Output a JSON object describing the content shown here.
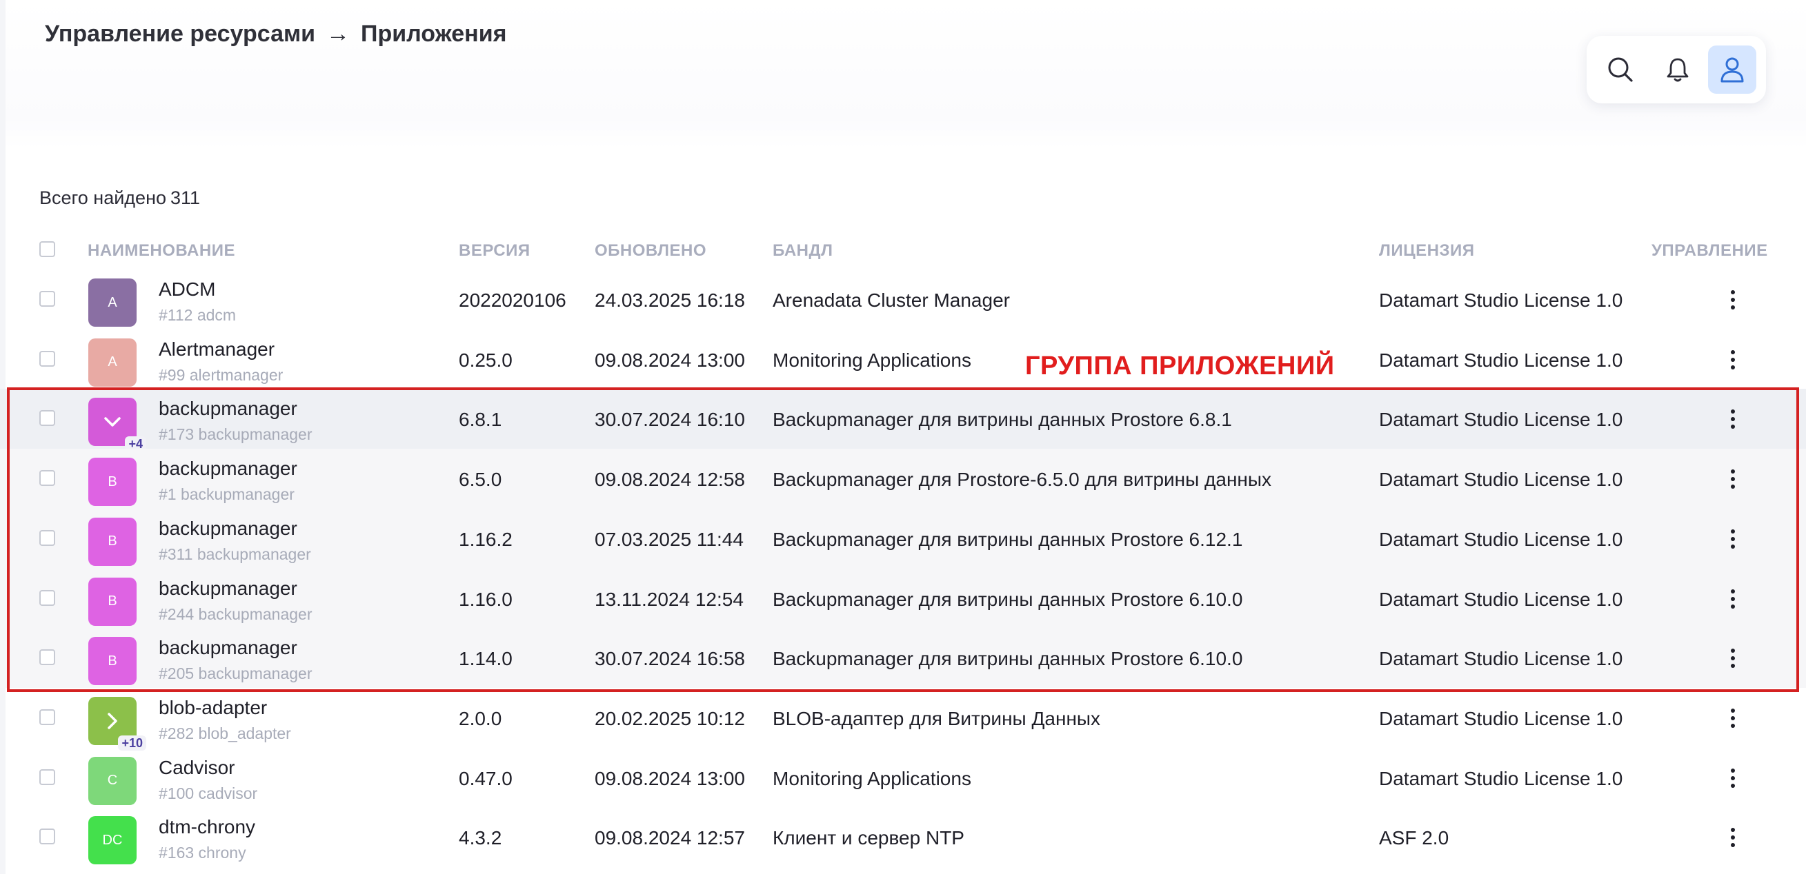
{
  "breadcrumb": {
    "parent": "Управление ресурсами",
    "separator": "→",
    "current": "Приложения"
  },
  "toolbar": {
    "icons": [
      "search-icon",
      "bell-icon",
      "user-icon"
    ]
  },
  "summary": {
    "label": "Всего найдено",
    "count": "311"
  },
  "columns": {
    "name": "НАИМЕНОВАНИЕ",
    "version": "ВЕРСИЯ",
    "updated": "ОБНОВЛЕНО",
    "bundle": "БАНДЛ",
    "license": "ЛИЦЕНЗИЯ",
    "actions": "УПРАВЛЕНИЕ"
  },
  "annotation": {
    "group_label": "ГРУППА ПРИЛОЖЕНИЙ",
    "color": "#d42121"
  },
  "rows": [
    {
      "avatar": "A",
      "color": "#8a6fa3",
      "name": "ADCM",
      "sub": "#112 adcm",
      "version": "2022020106",
      "updated": "24.03.2025 16:18",
      "bundle": "Arenadata Cluster Manager",
      "license": "Datamart Studio License 1.0"
    },
    {
      "avatar": "A",
      "color": "#e8aaa4",
      "name": "Alertmanager",
      "sub": "#99 alertmanager",
      "version": "0.25.0",
      "updated": "09.08.2024 13:00",
      "bundle": "Monitoring Applications",
      "license": "Datamart Studio License 1.0"
    },
    {
      "avatar": "chevron-down",
      "badge": "+4",
      "color": "#d45ad9",
      "name": "backupmanager",
      "sub": "#173 backupmanager",
      "version": "6.8.1",
      "updated": "30.07.2024 16:10",
      "bundle": "Backupmanager для витрины данных Prostore 6.8.1",
      "license": "Datamart Studio License 1.0"
    },
    {
      "avatar": "B",
      "color": "#de63e3",
      "name": "backupmanager",
      "sub": "#1 backupmanager",
      "version": "6.5.0",
      "updated": "09.08.2024 12:58",
      "bundle": "Backupmanager для Prostore-6.5.0 для витрины данных",
      "license": "Datamart Studio License 1.0"
    },
    {
      "avatar": "B",
      "color": "#de63e3",
      "name": "backupmanager",
      "sub": "#311 backupmanager",
      "version": "1.16.2",
      "updated": "07.03.2025 11:44",
      "bundle": "Backupmanager для витрины данных Prostore 6.12.1",
      "license": "Datamart Studio License 1.0"
    },
    {
      "avatar": "B",
      "color": "#de63e3",
      "name": "backupmanager",
      "sub": "#244 backupmanager",
      "version": "1.16.0",
      "updated": "13.11.2024 12:54",
      "bundle": "Backupmanager для витрины данных Prostore 6.10.0",
      "license": "Datamart Studio License 1.0"
    },
    {
      "avatar": "B",
      "color": "#de63e3",
      "name": "backupmanager",
      "sub": "#205 backupmanager",
      "version": "1.14.0",
      "updated": "30.07.2024 16:58",
      "bundle": "Backupmanager для витрины данных Prostore 6.10.0",
      "license": "Datamart Studio License 1.0"
    },
    {
      "avatar": "chevron-right",
      "badge": "+10",
      "color": "#8cc04a",
      "name": "blob-adapter",
      "sub": "#282 blob_adapter",
      "version": "2.0.0",
      "updated": "20.02.2025 10:12",
      "bundle": "BLOB-адаптер для Витрины Данных",
      "license": "Datamart Studio License 1.0"
    },
    {
      "avatar": "C",
      "color": "#7ed87a",
      "name": "Cadvisor",
      "sub": "#100 cadvisor",
      "version": "0.47.0",
      "updated": "09.08.2024 13:00",
      "bundle": "Monitoring Applications",
      "license": "Datamart Studio License 1.0"
    },
    {
      "avatar": "DC",
      "color": "#44e04c",
      "name": "dtm-chrony",
      "sub": "#163 chrony",
      "version": "4.3.2",
      "updated": "09.08.2024 12:57",
      "bundle": "Клиент и сервер NTP",
      "license": "ASF 2.0"
    }
  ]
}
